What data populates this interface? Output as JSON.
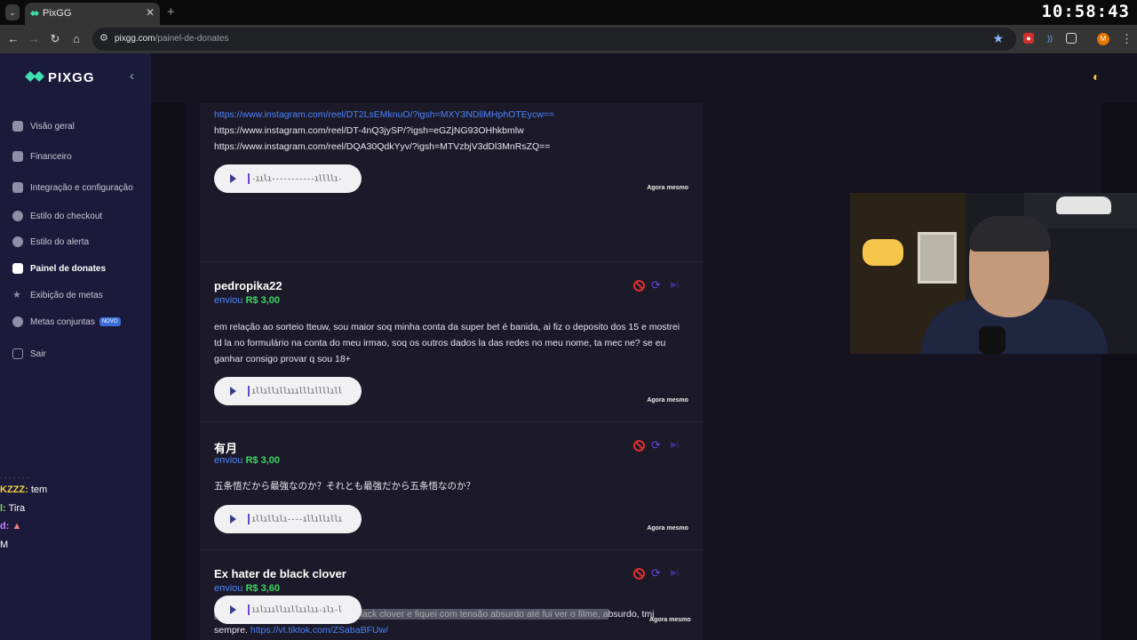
{
  "browser": {
    "tab_title": "PixGG",
    "clock": "10:58:43",
    "url_host": "pixgg.com",
    "url_path": "/painel-de-donates",
    "profile_initial": "M"
  },
  "sidebar": {
    "brand": "PIXGG",
    "items": [
      {
        "label": "Visão geral",
        "icon": "home-icon"
      },
      {
        "label": "Financeiro",
        "icon": "wallet-icon"
      },
      {
        "label": "Integração e configuração",
        "icon": "settings-list-icon"
      },
      {
        "label": "Estilo do checkout",
        "icon": "palette-icon"
      },
      {
        "label": "Estilo do alerta",
        "icon": "palette-icon"
      },
      {
        "label": "Painel de donates",
        "icon": "hand-icon",
        "active": true
      },
      {
        "label": "Exibição de metas",
        "icon": "star-icon"
      },
      {
        "label": "Metas conjuntas",
        "icon": "rocket-icon",
        "badge": "NOVO"
      },
      {
        "label": "Sair",
        "icon": "logout-icon"
      }
    ]
  },
  "overlay_chat": [
    {
      "user": "KZZZ:",
      "text": "tem",
      "color": "#f4d03f"
    },
    {
      "user": "l:",
      "text": "Tira",
      "color": "#7bd75b"
    },
    {
      "user": "d:",
      "text": "",
      "color": "#c77dff"
    },
    {
      "user": "",
      "text": "M",
      "color": "#ffffff"
    }
  ],
  "donations": [
    {
      "links": [
        "https://www.instagram.com/reel/DT2LsEMknuO/?igsh=MXY3NDllMHphOTEycw==",
        "https://www.instagram.com/reel/DT-4nQ3jySP/?igsh=eGZjNG93OHhkbmlw",
        "https://www.instagram.com/reel/DQA30QdkYyv/?igsh=MTVzbjV3dDl3MnRsZQ=="
      ],
      "waveform": "-ıılı-----------ıllllı-",
      "time": "Agora mesmo"
    },
    {
      "name": "pedropika22",
      "sent_label": "enviou",
      "amount": "R$ 3,00",
      "message": "em relação ao sorteio tteuw, sou maior soq minha conta da super bet é banida, ai fiz o deposito dos 15 e mostrei td la no formulário na conta do meu irmao, soq os outros dados la das redes no meu nome, ta mec ne? se eu ganhar consigo provar q sou 18+",
      "waveform": "ıllıllıllııılllıllllıll",
      "time": "Agora mesmo"
    },
    {
      "name": "有月",
      "sent_label": "enviou",
      "amount": "R$ 3,00",
      "message": "五条悟だから最強なのか？それとも最強だから五条悟なのか？",
      "waveform": "ıllıllılı----ıllıllıllı",
      "time": "Agora mesmo"
    },
    {
      "name": "Ex hater de black clover",
      "sent_label": "enviou",
      "amount": "R$ 3,60",
      "message_highlight": "Fala tteuw, recebi uns spoilers de black clover e fiquei com tensão absurdo até fui ver o filme, a",
      "message_rest": "bsurdo, tmj sempre.",
      "message_link": "https://vt.tiktok.com/ZSabaBFUw/",
      "waveform": "ıılıııllııllıılıı-ılı-l",
      "time": "Agora mesmo"
    }
  ],
  "colors": {
    "accent": "#4c83ff",
    "amount": "#3ed663",
    "sidebar": "#1c1a3b"
  }
}
